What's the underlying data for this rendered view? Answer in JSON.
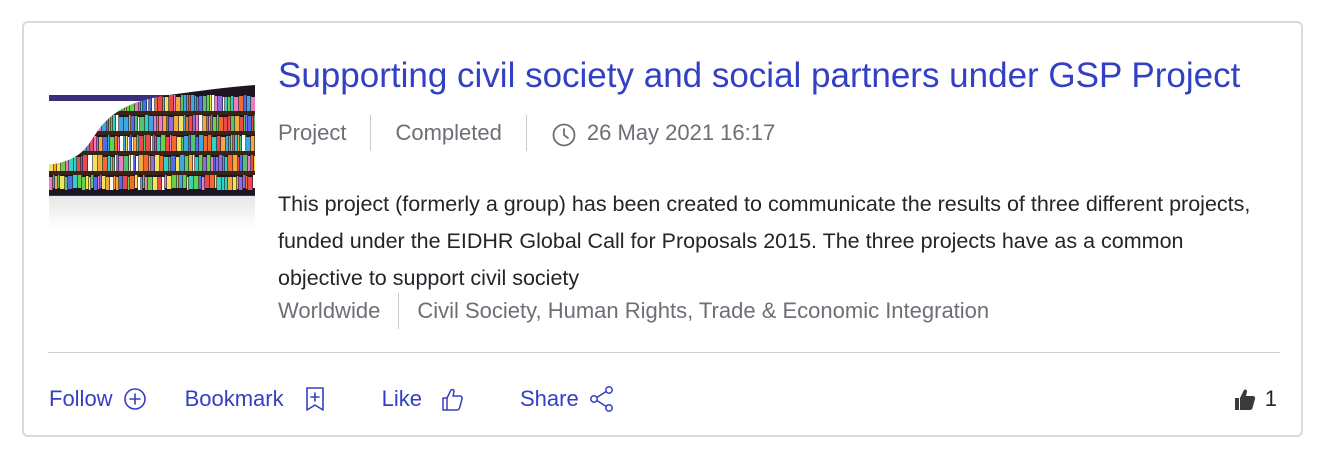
{
  "card": {
    "title": "Supporting civil society and social partners under GSP Project",
    "meta": {
      "type": "Project",
      "status": "Completed",
      "date": "26 May 2021 16:17"
    },
    "description": "This project (formerly a group) has been created to communicate the results of three different projects, funded under the EIDHR Global Call for Proposals 2015. The three projects have as a common objective to support civil society",
    "tags": {
      "region": "Worldwide",
      "topics": "Civil Society, Human Rights, Trade & Economic Integration"
    },
    "thumbnail_icon": "bookshelves-image"
  },
  "actions": {
    "follow": {
      "label": "Follow",
      "icon": "plus-circle-icon"
    },
    "bookmark": {
      "label": "Bookmark",
      "icon": "bookmark-plus-icon"
    },
    "like": {
      "label": "Like",
      "icon": "thumbs-up-outline-icon"
    },
    "share": {
      "label": "Share",
      "icon": "share-icon"
    }
  },
  "likes": {
    "count": "1",
    "icon": "thumbs-up-filled-icon"
  },
  "colors": {
    "title": "#3240c3",
    "action": "#3240c3",
    "meta": "#6c6f75",
    "body": "#23252a",
    "border": "#d9d9dc"
  }
}
